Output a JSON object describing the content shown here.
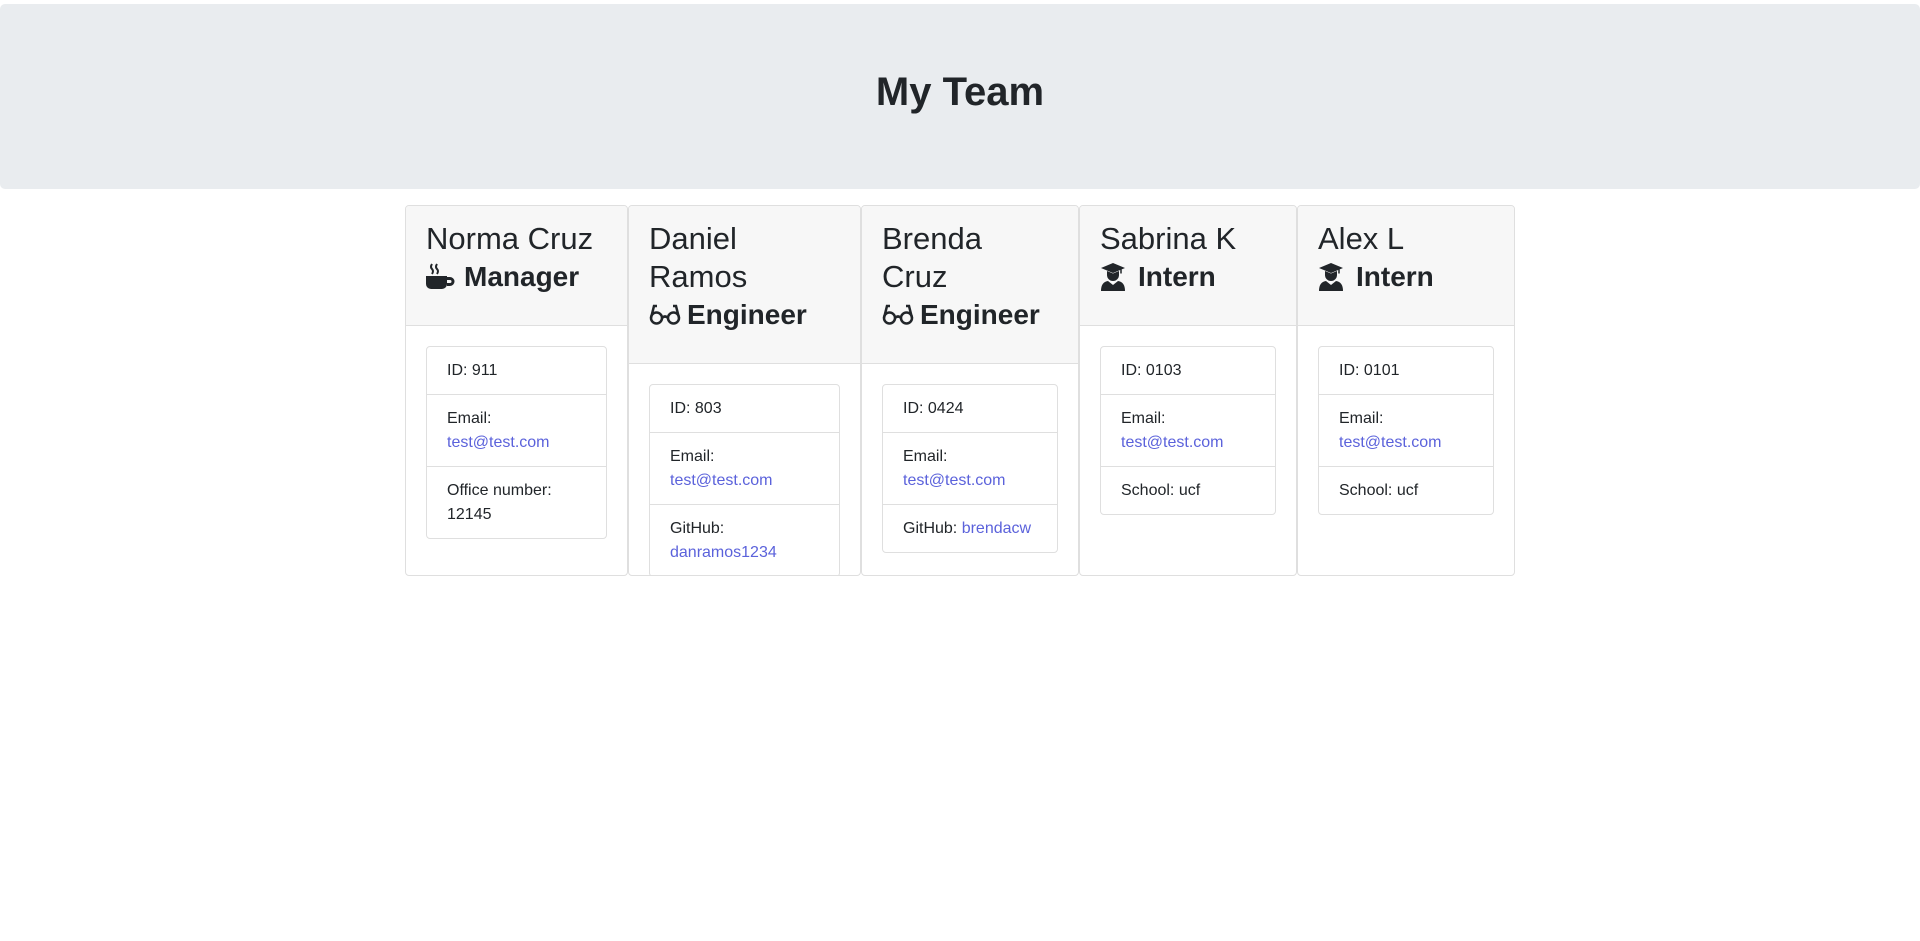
{
  "header": {
    "title": "My Team"
  },
  "labels": {
    "id_prefix": "ID: ",
    "email_prefix": "Email: ",
    "office_prefix": "Office number: ",
    "github_prefix": "GitHub: ",
    "school_prefix": "School: "
  },
  "employees": [
    {
      "name": "Norma Cruz",
      "role": "Manager",
      "icon": "coffee-icon",
      "id": "911",
      "email": "test@test.com",
      "office": "12145"
    },
    {
      "name": "Daniel Ramos",
      "role": "Engineer",
      "icon": "glasses-icon",
      "id": "803",
      "email": "test@test.com",
      "github": "danramos1234"
    },
    {
      "name": "Brenda Cruz",
      "role": "Engineer",
      "icon": "glasses-icon",
      "id": "0424",
      "email": "test@test.com",
      "github": "brendacw"
    },
    {
      "name": "Sabrina K",
      "role": "Intern",
      "icon": "graduate-icon",
      "id": "0103",
      "email": "test@test.com",
      "school": "ucf"
    },
    {
      "name": "Alex L",
      "role": "Intern",
      "icon": "graduate-icon",
      "id": "0101",
      "email": "test@test.com",
      "school": "ucf"
    }
  ],
  "colors": {
    "link": "#5b62db",
    "jumbotron": "#e9ecef",
    "card_header": "#f7f7f7"
  }
}
